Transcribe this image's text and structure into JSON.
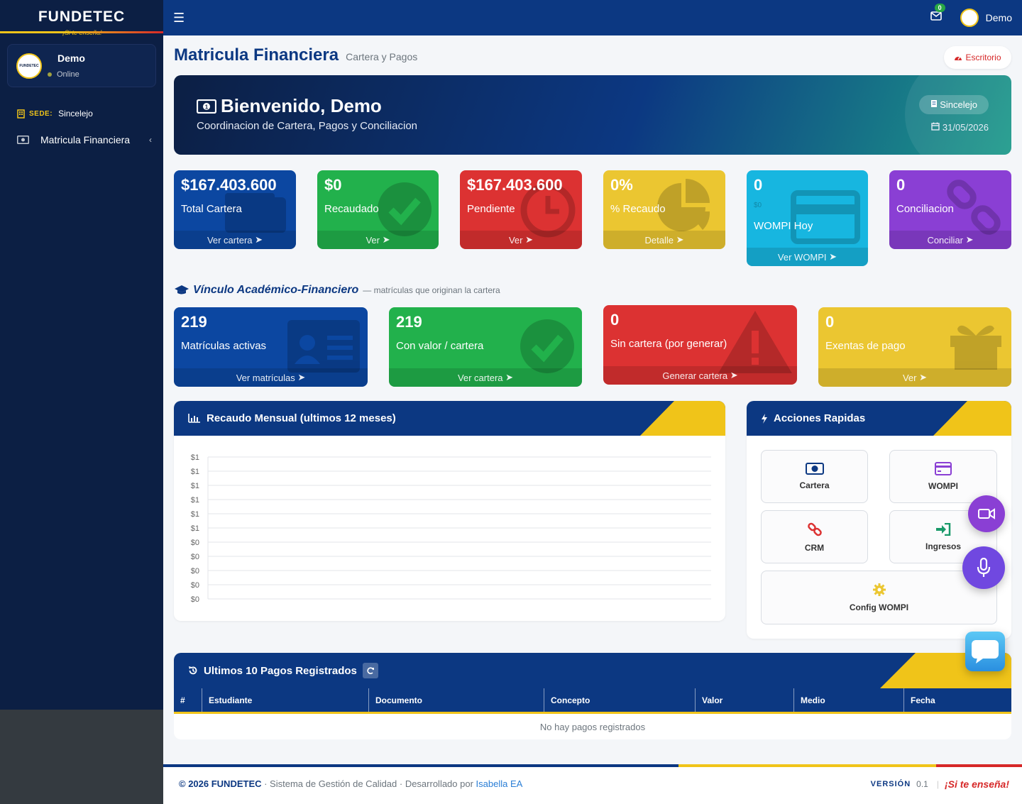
{
  "brand": {
    "name": "FUNDETEC",
    "slogan": "¡Si te enseña!",
    "logo_text": "FUNDETEC"
  },
  "user": {
    "name": "Demo",
    "status": "Online"
  },
  "sidebar": {
    "sede_label": "SEDE:",
    "sede_value": "Sincelejo",
    "items": [
      {
        "label": "Matricula Financiera",
        "icon": "money-bill-icon"
      }
    ]
  },
  "topbar": {
    "mail_badge": "0",
    "user_name": "Demo"
  },
  "header": {
    "title": "Matricula Financiera",
    "subtitle": "Cartera y Pagos",
    "escritorio_label": "Escritorio"
  },
  "welcome": {
    "title": "Bienvenido, Demo",
    "subtitle": "Coordinacion de Cartera, Pagos y Conciliacion",
    "sede": "Sincelejo",
    "date": "31/05/2026"
  },
  "stats": [
    {
      "value": "$167.403.600",
      "label": "Total Cartera",
      "link": "Ver cartera",
      "color": "#0c47a1"
    },
    {
      "value": "$0",
      "label": "Recaudado",
      "link": "Ver",
      "color": "#22b14c"
    },
    {
      "value": "$167.403.600",
      "label": "Pendiente",
      "link": "Ver",
      "color": "#dc3232"
    },
    {
      "value": "0%",
      "label": "% Recaudo",
      "link": "Detalle",
      "color": "#ebc631"
    },
    {
      "value": "0",
      "sub": "$0",
      "label": "WOMPI Hoy",
      "link": "Ver WOMPI",
      "color": "#17b6e0"
    },
    {
      "value": "0",
      "label": "Conciliacion",
      "link": "Conciliar",
      "color": "#8a3fd4"
    }
  ],
  "vinculo": {
    "title": "Vínculo Académico-Financiero",
    "note": "— matrículas que originan la cartera",
    "boxes": [
      {
        "value": "219",
        "label": "Matrículas activas",
        "link": "Ver matrículas"
      },
      {
        "value": "219",
        "label": "Con valor / cartera",
        "link": "Ver cartera"
      },
      {
        "value": "0",
        "label": "Sin cartera (por generar)",
        "link": "Generar cartera"
      },
      {
        "value": "0",
        "label": "Exentas de pago",
        "link": "Ver"
      }
    ]
  },
  "recaudo": {
    "title": "Recaudo Mensual (ultimos 12 meses)"
  },
  "chart_data": {
    "type": "bar",
    "title": "Recaudo Mensual (ultimos 12 meses)",
    "categories": [],
    "series": [],
    "ytick_labels": [
      "$1",
      "$1",
      "$1",
      "$1",
      "$1",
      "$1",
      "$0",
      "$0",
      "$0",
      "$0",
      "$0"
    ],
    "grid": true
  },
  "acciones": {
    "title": "Acciones Rapidas",
    "buttons": [
      {
        "label": "Cartera",
        "icon": "money-bill-icon"
      },
      {
        "label": "WOMPI",
        "icon": "credit-card-icon"
      },
      {
        "label": "CRM",
        "icon": "link-icon"
      },
      {
        "label": "Ingresos",
        "icon": "sign-in-icon"
      },
      {
        "label": "Config WOMPI",
        "icon": "gear-icon"
      }
    ]
  },
  "pagos": {
    "title": "Ultimos 10 Pagos Registrados",
    "columns": [
      "#",
      "Estudiante",
      "Documento",
      "Concepto",
      "Valor",
      "Medio",
      "Fecha"
    ],
    "empty": "No hay pagos registrados"
  },
  "footer": {
    "copyright": "© 2026 FUNDETEC",
    "text": " · Sistema de Gestión de Calidad · Desarrollado por ",
    "developer": "Isabella EA",
    "version_label": "VERSIÓN",
    "version": "0.1",
    "slogan": "¡Si te enseña!"
  },
  "colors": {
    "primary": "#0c3882",
    "accent": "#f0c419",
    "danger": "#d62828",
    "sidebar": "#0c1f44"
  }
}
